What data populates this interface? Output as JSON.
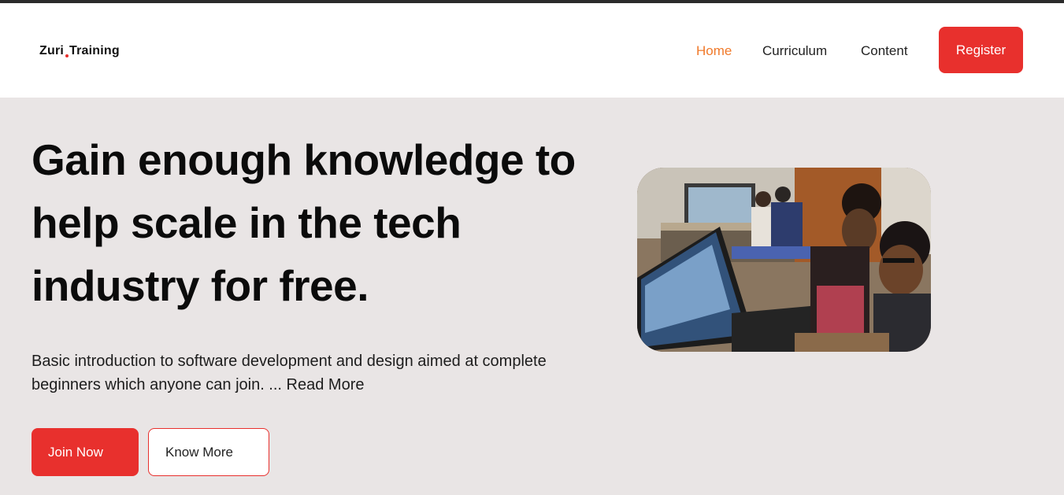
{
  "brand": {
    "logo_left": "Zuri",
    "logo_right": "Training"
  },
  "nav": {
    "home": "Home",
    "curriculum": "Curriculum",
    "content": "Content",
    "register": "Register"
  },
  "hero": {
    "title": "Gain enough knowledge to help scale in the tech industry for free.",
    "description": "Basic introduction to software development and design aimed at complete beginners which anyone can join. ... Read More",
    "primary_cta": "Join Now",
    "secondary_cta": "Know More"
  },
  "colors": {
    "accent": "#e8302d",
    "active_nav": "#f07a2b",
    "hero_background": "#e9e5e5"
  }
}
